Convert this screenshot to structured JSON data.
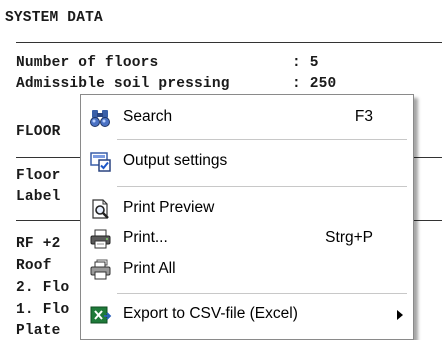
{
  "report": {
    "heading": "SYSTEM DATA",
    "floors_line": "Number of floors               : 5",
    "soil_line": "Admissible soil pressing       : 250",
    "floor_heading": "FLOOR",
    "floor_row": "Floor",
    "label_row": "Label",
    "row_rf": "RF +2",
    "row_roof": "Roof",
    "row_2": "2. Flo",
    "row_1": "1. Flo",
    "row_plate": "Plate"
  },
  "context_menu": {
    "search": {
      "label": "Search",
      "shortcut": "F3",
      "icon": "binoculars-icon"
    },
    "output_settings": {
      "label": "Output settings",
      "icon": "settings-checkbox-icon"
    },
    "print_preview": {
      "label": "Print Preview",
      "icon": "print-preview-icon"
    },
    "print": {
      "label": "Print...",
      "shortcut": "Strg+P",
      "icon": "printer-icon"
    },
    "print_all": {
      "label": "Print All",
      "icon": "print-all-icon"
    },
    "export_csv": {
      "label": "Export to CSV-file (Excel)",
      "icon": "excel-export-icon"
    }
  }
}
